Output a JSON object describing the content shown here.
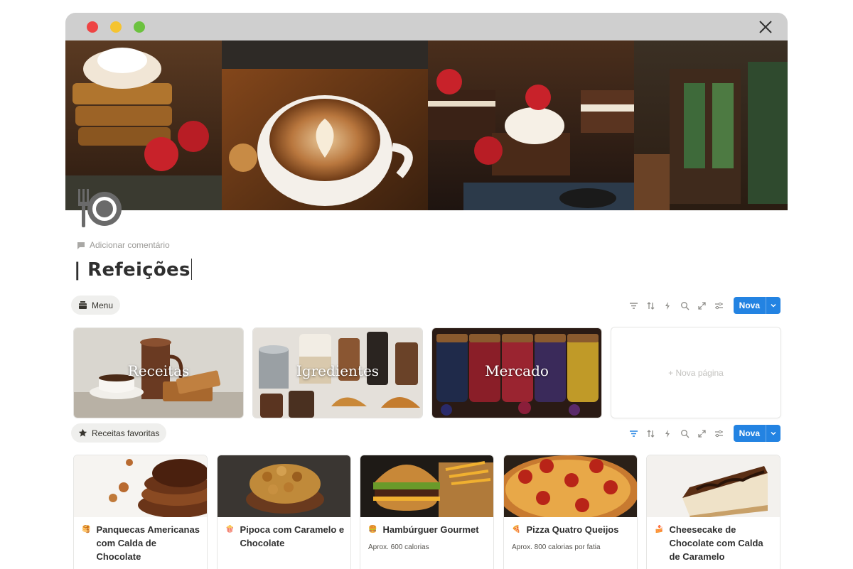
{
  "window": {
    "close_icon": "close-icon"
  },
  "page": {
    "icon": "fork-plate-icon",
    "add_comment": "Adicionar comentário",
    "title": "| Refeições"
  },
  "views": {
    "menu_tab": {
      "label": "Menu",
      "icon": "container-icon"
    },
    "favorites_tab": {
      "label": "Receitas favoritas",
      "icon": "star-icon"
    }
  },
  "toolbar": {
    "new_label": "Nova",
    "tools": [
      "filter-icon",
      "sort-icon",
      "lightning-icon",
      "search-icon",
      "expand-icon",
      "settings-icon"
    ]
  },
  "categories": [
    {
      "label": "Receitas"
    },
    {
      "label": "Igredientes"
    },
    {
      "label": "Mercado"
    }
  ],
  "new_page_label": "+ Nova página",
  "recipes": [
    {
      "emoji": "🥞",
      "title": "Panquecas Americanas com Calda de Chocolate",
      "subtitle": ""
    },
    {
      "emoji": "🍿",
      "title": "Pipoca com Caramelo e Chocolate",
      "subtitle": ""
    },
    {
      "emoji": "🍔",
      "title": "Hambúrguer Gourmet",
      "subtitle": "Aprox. 600 calorias"
    },
    {
      "emoji": "🍕",
      "title": "Pizza Quatro Queijos",
      "subtitle": "Aprox. 800 calorias por fatia"
    },
    {
      "emoji": "🍰",
      "title": "Cheesecake de Chocolate com Calda de Caramelo",
      "subtitle": ""
    }
  ],
  "colors": {
    "accent": "#2383e2",
    "titlebar": "#cfcfcf"
  }
}
